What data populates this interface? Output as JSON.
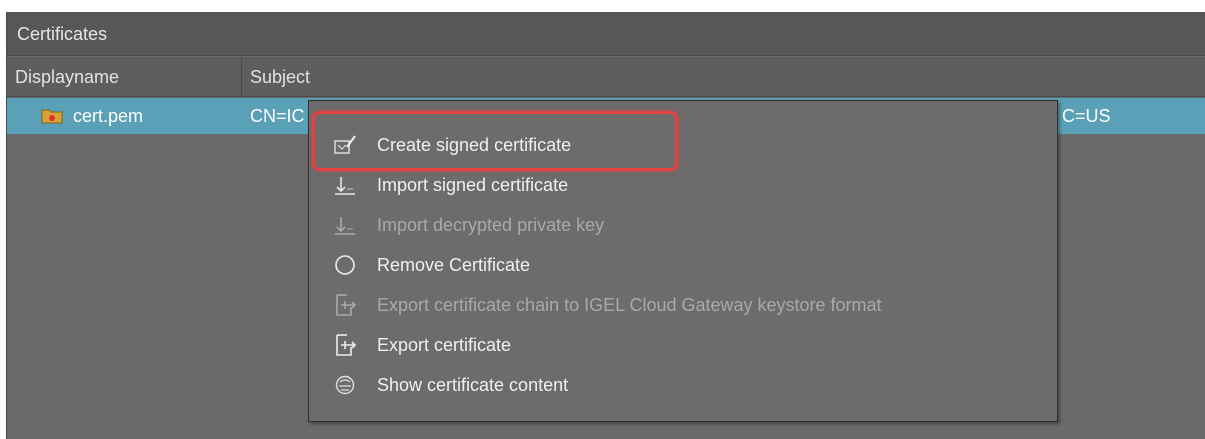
{
  "panel": {
    "title": "Certificates"
  },
  "table": {
    "columns": [
      "Displayname",
      "Subject"
    ],
    "rows": [
      {
        "displayname": "cert.pem",
        "subject_visible_left": "CN=IC",
        "subject_visible_right": "a, C=US",
        "selected": true
      }
    ]
  },
  "context_menu": {
    "items": [
      {
        "label": "Create signed certificate",
        "icon": "create-signed-certificate-icon",
        "enabled": true,
        "highlighted": true
      },
      {
        "label": "Import signed certificate",
        "icon": "import-icon",
        "enabled": true
      },
      {
        "label": "Import decrypted private key",
        "icon": "import-icon",
        "enabled": false
      },
      {
        "label": "Remove Certificate",
        "icon": "remove-circle-icon",
        "enabled": true
      },
      {
        "label": "Export certificate chain to IGEL Cloud Gateway keystore format",
        "icon": "export-icon",
        "enabled": false
      },
      {
        "label": "Export certificate",
        "icon": "export-icon",
        "enabled": true
      },
      {
        "label": "Show certificate content",
        "icon": "show-content-icon",
        "enabled": true
      }
    ]
  },
  "colors": {
    "selected_row": "#5aa0b6",
    "highlight_border": "#e8403e",
    "panel_background": "#6a6a6a"
  }
}
